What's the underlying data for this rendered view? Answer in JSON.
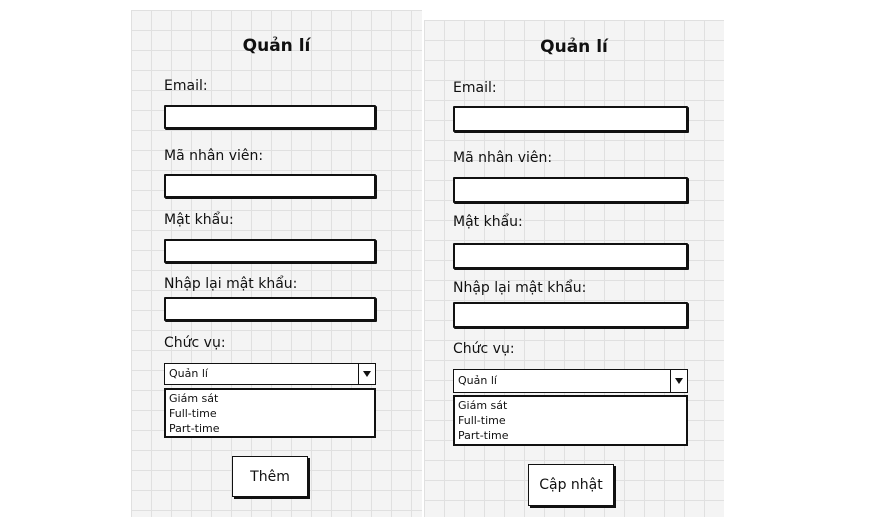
{
  "left_form": {
    "title": "Quản lí",
    "email_label": "Email:",
    "employee_id_label": "Mã nhân viên:",
    "password_label": "Mật khẩu:",
    "confirm_password_label": "Nhập lại mật khẩu:",
    "role_label": "Chức vụ:",
    "role_selected": "Quản lí",
    "role_options": [
      "Giám sát",
      "Full-time",
      "Part-time"
    ],
    "submit_label": "Thêm"
  },
  "right_form": {
    "title": "Quản lí",
    "email_label": "Email:",
    "employee_id_label": "Mã nhân viên:",
    "password_label": "Mật khẩu:",
    "confirm_password_label": "Nhập lại mật khẩu:",
    "role_label": "Chức vụ:",
    "role_selected": "Quản lí",
    "role_options": [
      "Giám sát",
      "Full-time",
      "Part-time"
    ],
    "submit_label": "Cập nhật"
  }
}
